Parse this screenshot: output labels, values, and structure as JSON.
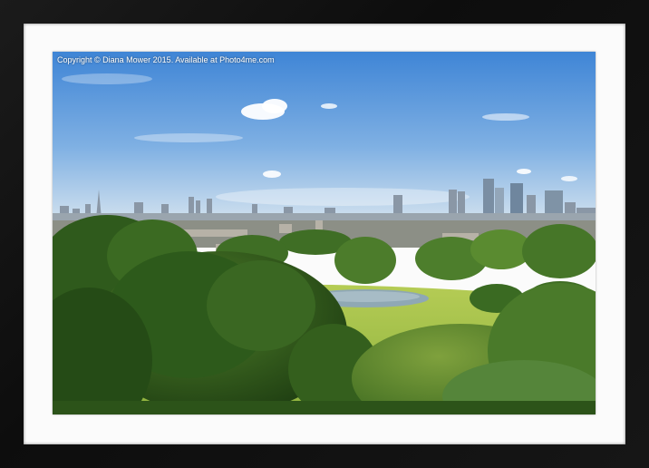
{
  "photo": {
    "caption": "Copyright © Diana Mower 2015. Available at Photo4me.com",
    "subject": "landscape-city-skyline-park"
  },
  "colors": {
    "frame": "#111111",
    "mount": "#fbfbfb",
    "sky_top": "#4f8fd8",
    "sky_bottom": "#cfe0ef",
    "grass": "#9cbd49",
    "tree_dark": "#2d5a1b",
    "tree_light": "#5d8a2e"
  }
}
